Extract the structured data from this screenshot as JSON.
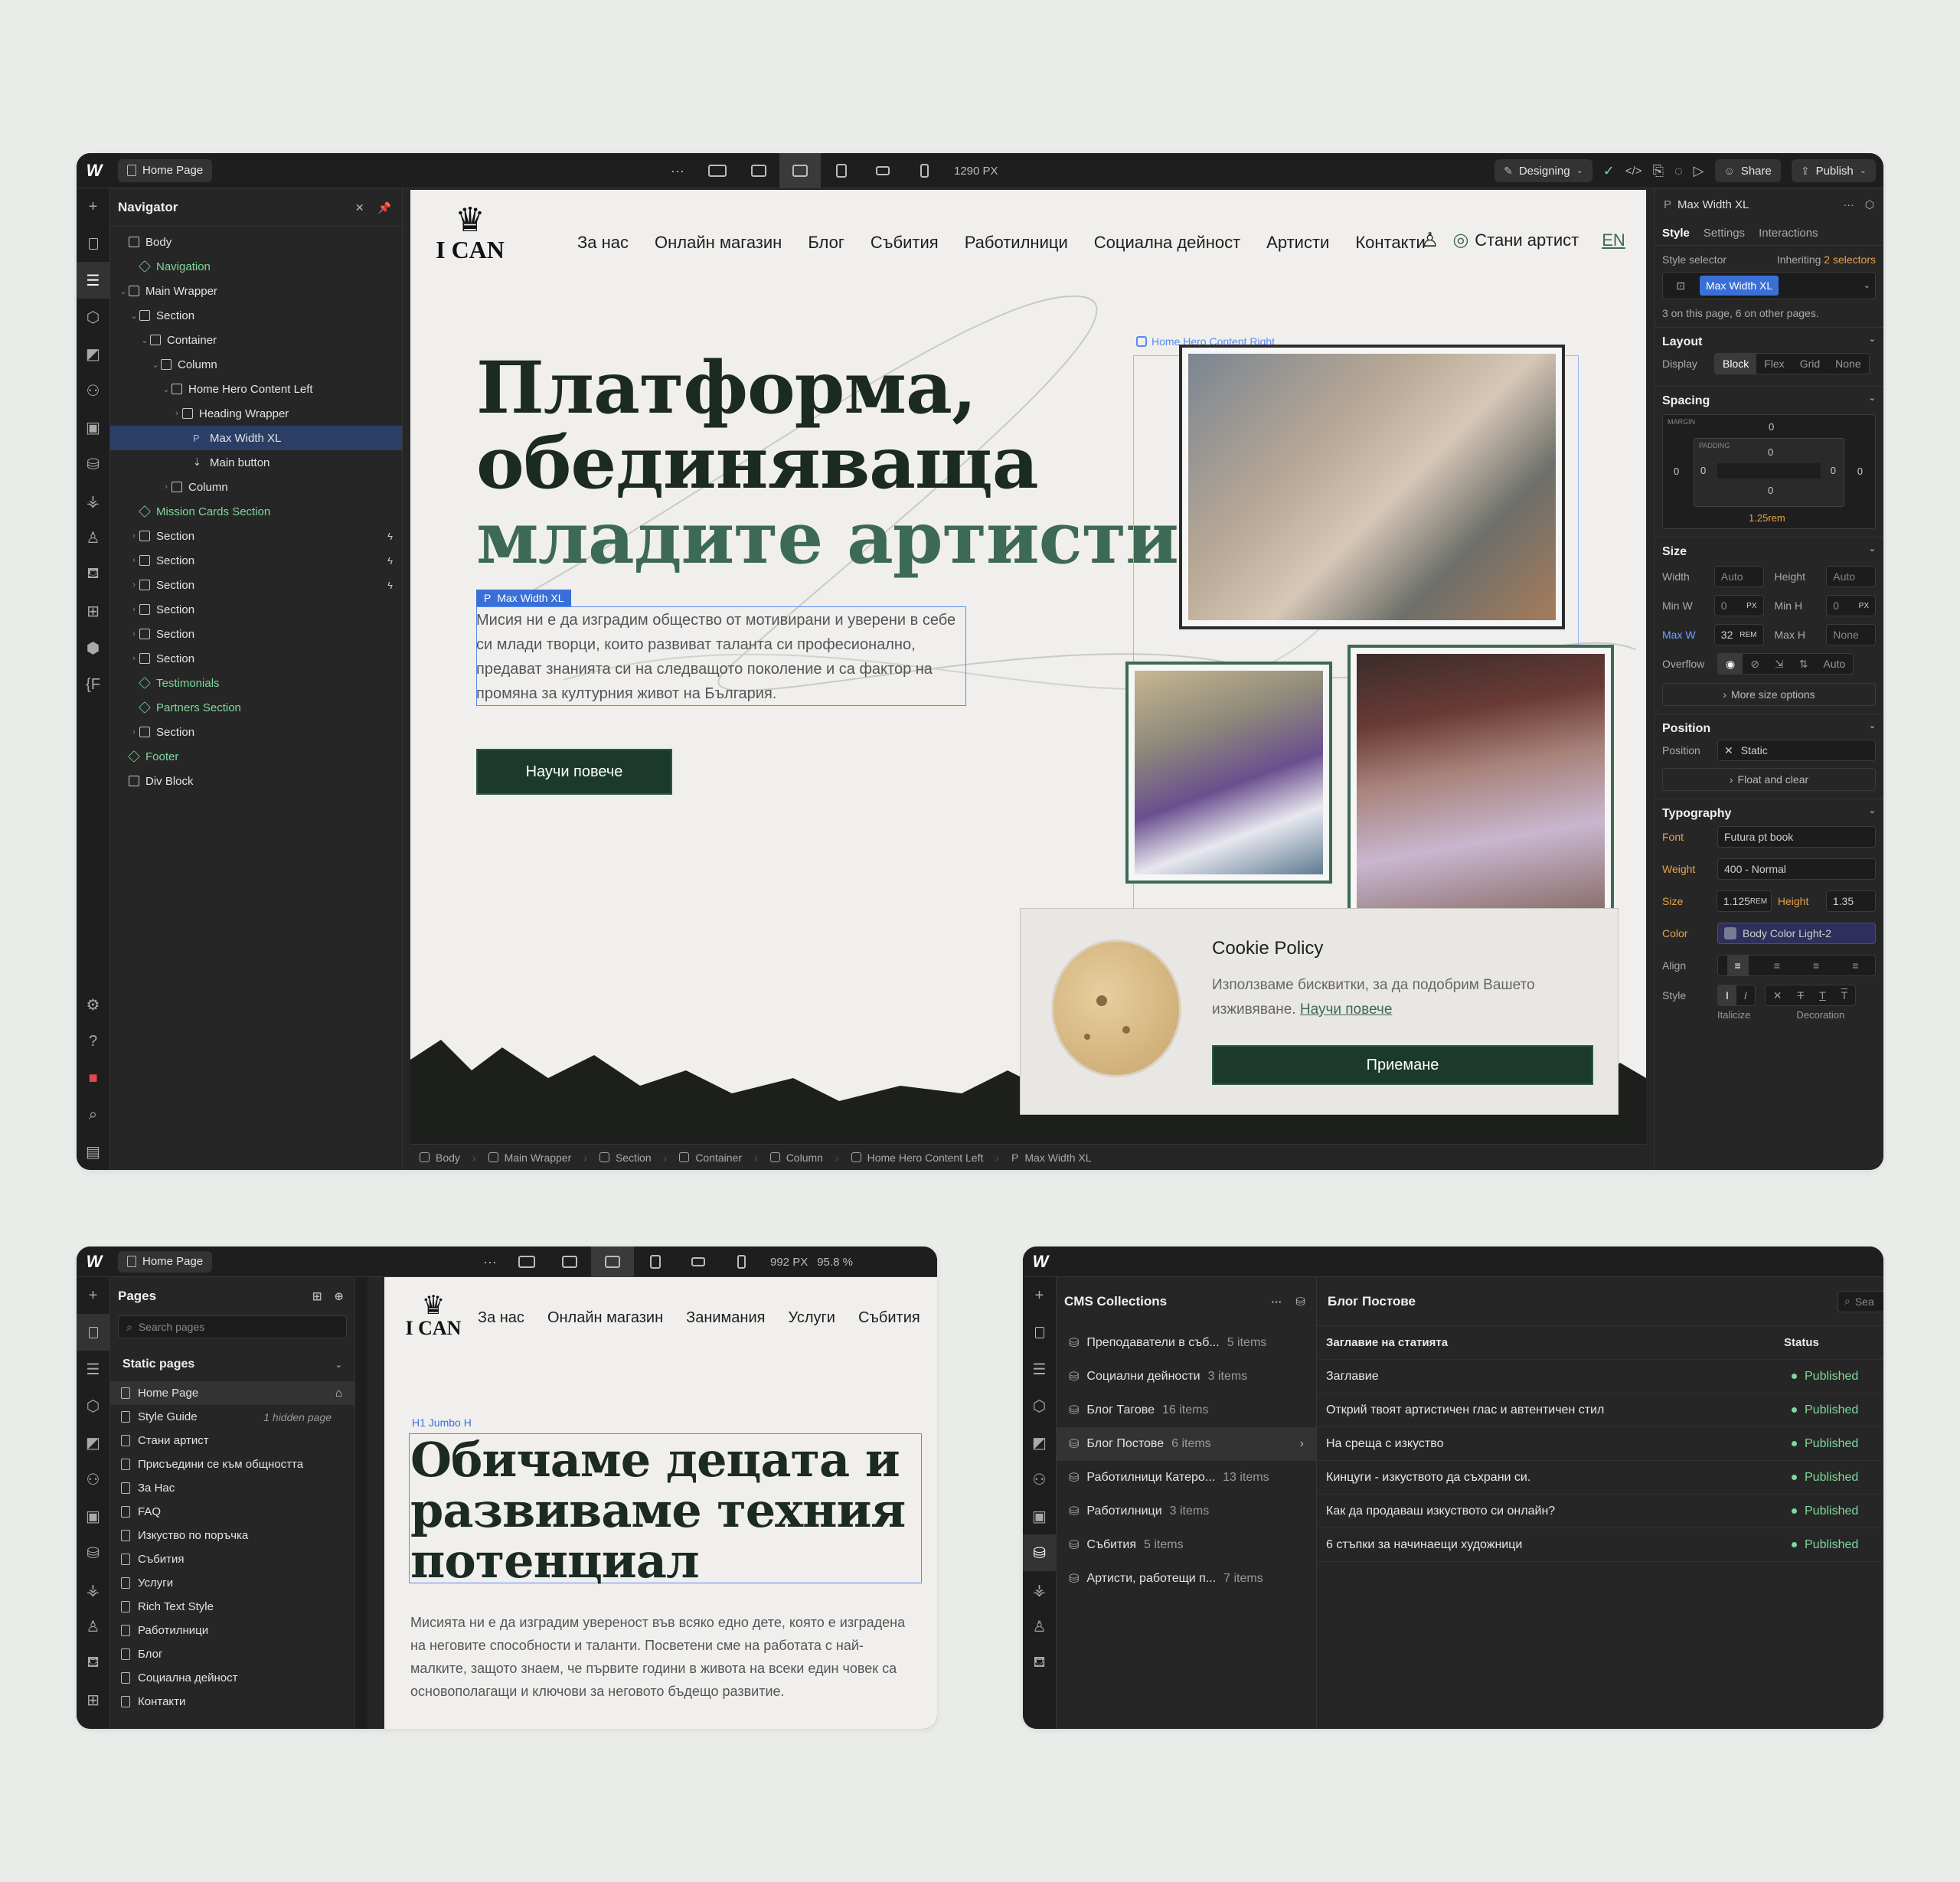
{
  "main_window": {
    "page_pill": "Home Page",
    "viewport": "1290 PX",
    "mode": "Designing",
    "share": "Share",
    "publish": "Publish",
    "navigator": {
      "title": "Navigator",
      "tree": [
        {
          "label": "Body",
          "kind": "box"
        },
        {
          "label": "Navigation",
          "kind": "comp"
        },
        {
          "label": "Main Wrapper",
          "kind": "box"
        },
        {
          "label": "Section",
          "kind": "box"
        },
        {
          "label": "Container",
          "kind": "box"
        },
        {
          "label": "Column",
          "kind": "box"
        },
        {
          "label": "Home Hero Content Left",
          "kind": "box"
        },
        {
          "label": "Heading Wrapper",
          "kind": "box"
        },
        {
          "label": "Max Width XL",
          "kind": "p"
        },
        {
          "label": "Main button",
          "kind": "link"
        },
        {
          "label": "Column",
          "kind": "box"
        },
        {
          "label": "Mission Cards Section",
          "kind": "comp"
        },
        {
          "label": "Section",
          "kind": "box"
        },
        {
          "label": "Section",
          "kind": "box"
        },
        {
          "label": "Section",
          "kind": "box"
        },
        {
          "label": "Section",
          "kind": "box"
        },
        {
          "label": "Section",
          "kind": "box"
        },
        {
          "label": "Section",
          "kind": "box"
        },
        {
          "label": "Testimonials",
          "kind": "comp"
        },
        {
          "label": "Partners Section",
          "kind": "comp"
        },
        {
          "label": "Section",
          "kind": "box"
        },
        {
          "label": "Footer",
          "kind": "comp"
        },
        {
          "label": "Div Block",
          "kind": "box"
        }
      ]
    },
    "site": {
      "logo": "I CAN",
      "nav": [
        "За нас",
        "Онлайн магазин",
        "Блог",
        "Събития",
        "Работилници",
        "Социална дейност",
        "Артисти",
        "Контакти"
      ],
      "become_artist": "Стани артист",
      "lang": "EN",
      "hero_line1": "Платформа,",
      "hero_line2": "обединяваща",
      "hero_line3": "младите артисти",
      "selected_badge": "Max Width XL",
      "right_badge": "Home Hero Content Right",
      "hero_text": "Мисия ни е да изградим общество от мотивирани и уверени в себе си млади творци, които развиват таланта си професионално, предават знанията си на следващото поколение и са фактор на промяна за културния живот на България.",
      "cta": "Научи повече",
      "cookie_title": "Cookie Policy",
      "cookie_text": "Използваме бисквитки, за да подобрим Вашето изживяване.",
      "cookie_link": "Научи повече",
      "cookie_accept": "Приемане"
    },
    "breadcrumbs": [
      "Body",
      "Main Wrapper",
      "Section",
      "Container",
      "Column",
      "Home Hero Content Left",
      "Max Width XL"
    ],
    "style_panel": {
      "element": "Max Width XL",
      "tabs": [
        "Style",
        "Settings",
        "Interactions"
      ],
      "style_selector": "Style selector",
      "inheriting_prefix": "Inheriting",
      "inheriting_count": "2 selectors",
      "class_chip": "Max Width XL",
      "usage": "3 on this page, 6 on other pages.",
      "layout_title": "Layout",
      "display_label": "Display",
      "display_opts": [
        "Block",
        "Flex",
        "Grid",
        "None"
      ],
      "spacing_title": "Spacing",
      "margin_label": "MARGIN",
      "padding_label": "PADDING",
      "zero": "0",
      "margin_bottom": "1.25rem",
      "size_title": "Size",
      "width_label": "Width",
      "width_val": "Auto",
      "height_label": "Height",
      "height_val": "Auto",
      "minw_label": "Min W",
      "minw_val": "0",
      "minw_unit": "PX",
      "minh_label": "Min H",
      "minh_val": "0",
      "minh_unit": "PX",
      "maxw_label": "Max W",
      "maxw_val": "32",
      "maxw_unit": "REM",
      "maxh_label": "Max H",
      "maxh_val": "None",
      "overflow_label": "Overflow",
      "overflow_auto": "Auto",
      "more_size": "More size options",
      "position_title": "Position",
      "position_label": "Position",
      "position_val": "Static",
      "float_clear": "Float and clear",
      "typography_title": "Typography",
      "font_label": "Font",
      "font_val": "Futura pt book",
      "weight_label": "Weight",
      "weight_val": "400 - Normal",
      "size_label": "Size",
      "size_val": "1.125",
      "size_unit": "REM",
      "lh_label": "Height",
      "lh_val": "1.35",
      "color_label": "Color",
      "color_val": "Body Color Light-2",
      "align_label": "Align",
      "style_label": "Style",
      "italicize": "Italicize",
      "decoration": "Decoration"
    }
  },
  "pages_window": {
    "page_pill": "Home Page",
    "viewport": "992 PX",
    "zoom": "95.8 %",
    "panel_title": "Pages",
    "search_placeholder": "Search pages",
    "static_pages": "Static pages",
    "pages": [
      "Home Page",
      "Style Guide",
      "Стани артист",
      "Присъедини се към общността",
      "За Нас",
      "FAQ",
      "Изкуство по поръчка",
      "Събития",
      "Услуги",
      "Rich Text Style",
      "Работилници",
      "Блог",
      "Социална дейност",
      "Контакти"
    ],
    "hidden_note": "1 hidden page",
    "site_nav": [
      "За нас",
      "Онлайн магазин",
      "Занимания",
      "Услуги",
      "Събития"
    ],
    "logo": "I CAN",
    "h1_badge": "H1  Jumbo H",
    "h1": "Обичаме децата и развиваме техния потенциал",
    "body": "Мисията ни е да изградим увереност във всяко едно дете, която е изградена на неговите способности и таланти. Посветени сме на работата с най-малките, защото знаем, че първите години в живота на всеки един човек са основополагащи и ключови за неговото бъдещо развитие."
  },
  "cms_window": {
    "panel_title": "CMS Collections",
    "collections": [
      {
        "name": "Преподаватели в съб...",
        "count": "5 items"
      },
      {
        "name": "Социални дейности",
        "count": "3 items"
      },
      {
        "name": "Блог Тагове",
        "count": "16 items"
      },
      {
        "name": "Блог Постове",
        "count": "6 items"
      },
      {
        "name": "Работилници Катеро...",
        "count": "13 items"
      },
      {
        "name": "Работилници",
        "count": "3 items"
      },
      {
        "name": "Събития",
        "count": "5 items"
      },
      {
        "name": "Артисти, работещи п...",
        "count": "7 items"
      }
    ],
    "collection_title": "Блог Постове",
    "search_placeholder": "Sea",
    "col_title": "Заглавие на статията",
    "col_status": "Status",
    "rows": [
      {
        "title": "Заглавие",
        "status": "Published"
      },
      {
        "title": "Открий твоят артистичен глас и автентичен стил",
        "status": "Published"
      },
      {
        "title": "На среща с изкуство",
        "status": "Published"
      },
      {
        "title": "Кинцуги - изкуството да съхрани си.",
        "status": "Published"
      },
      {
        "title": "Как да продаваш изкуството си онлайн?",
        "status": "Published"
      },
      {
        "title": "6 стъпки за начинаещи художници",
        "status": "Published"
      }
    ]
  },
  "colors": {
    "accent_green": "#3d6a55",
    "dark_green": "#1b3a2b",
    "selection_blue": "#3a6fd8",
    "published": "#7ed99a"
  }
}
